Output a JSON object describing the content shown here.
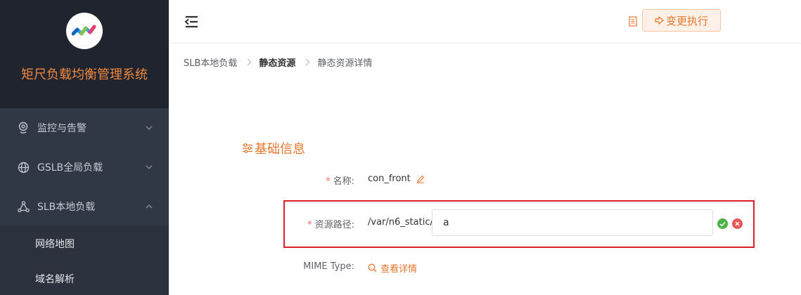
{
  "app": {
    "title": "矩尺负载均衡管理系统"
  },
  "sidebar": {
    "items": [
      {
        "label": "监控与告警",
        "icon": "location-pin-icon",
        "expanded": false
      },
      {
        "label": "GSLB全局负载",
        "icon": "globe-icon",
        "expanded": false
      },
      {
        "label": "SLB本地负载",
        "icon": "share-nodes-icon",
        "expanded": true
      }
    ],
    "sub_items": [
      {
        "label": "网络地图"
      },
      {
        "label": "域名解析"
      }
    ]
  },
  "header": {
    "exec_label": "变更执行"
  },
  "breadcrumb": {
    "items": [
      "SLB本地负载",
      "静态资源",
      "静态资源详情"
    ]
  },
  "main": {
    "section_title": "基础信息",
    "name": {
      "label": "名称:",
      "value": "con_front"
    },
    "resource_path": {
      "label": "资源路径:",
      "prefix": "/var/n6_static/",
      "input_value": "a"
    },
    "mime": {
      "label": "MIME Type:",
      "link_label": "查看详情"
    }
  },
  "colors": {
    "accent": "#e8772e",
    "sidebar_bg": "#303846",
    "brand_bg": "#1f242e",
    "highlight_border": "#dd1f2a",
    "success": "#4cb244",
    "danger": "#e85757"
  }
}
